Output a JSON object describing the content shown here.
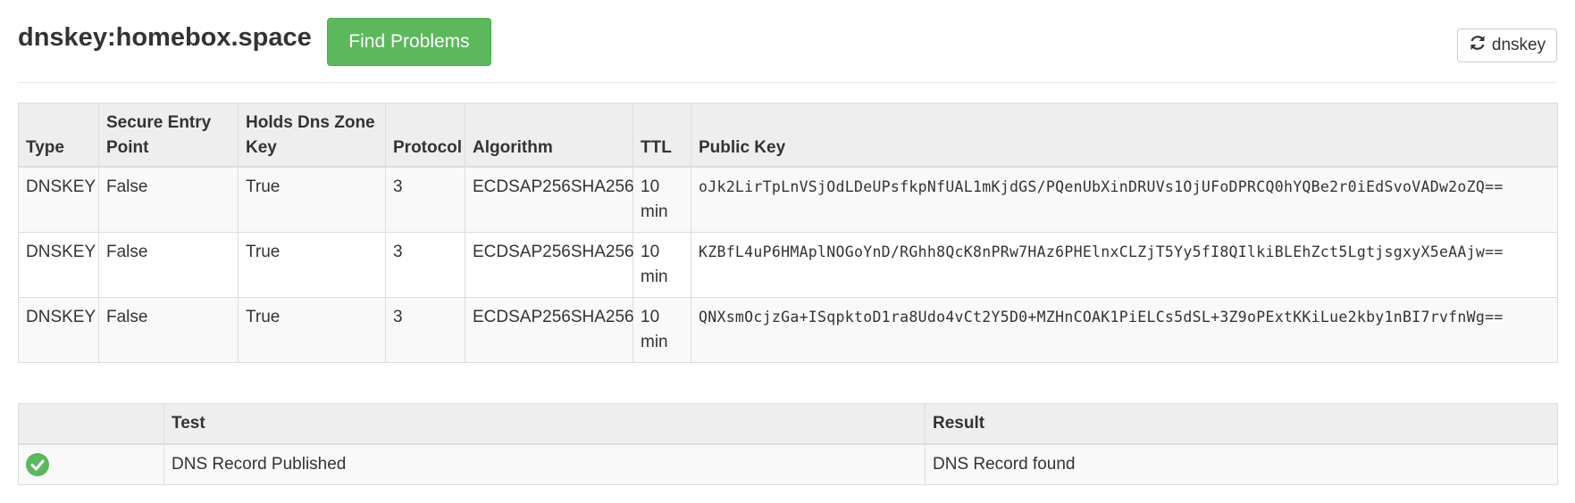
{
  "header": {
    "title": "dnskey:homebox.space",
    "find_button": "Find Problems",
    "refresh_button": "dnskey",
    "refresh_icon": "refresh-icon"
  },
  "dnskey_table": {
    "columns": [
      "Type",
      "Secure Entry Point",
      "Holds Dns Zone Key",
      "Protocol",
      "Algorithm",
      "TTL",
      "Public Key"
    ],
    "rows": [
      {
        "type": "DNSKEY",
        "sep": "False",
        "zone_key": "True",
        "protocol": "3",
        "algorithm": "ECDSAP256SHA256",
        "ttl": "10 min",
        "public_key": "oJk2LirTpLnVSjOdLDeUPsfkpNfUAL1mKjdGS/PQenUbXinDRUVs1OjUFoDPRCQ0hYQBe2r0iEdSvoVADw2oZQ=="
      },
      {
        "type": "DNSKEY",
        "sep": "False",
        "zone_key": "True",
        "protocol": "3",
        "algorithm": "ECDSAP256SHA256",
        "ttl": "10 min",
        "public_key": "KZBfL4uP6HMAplNOGoYnD/RGhh8QcK8nPRw7HAz6PHElnxCLZjT5Yy5fI8QIlkiBLEhZct5LgtjsgxyX5eAAjw=="
      },
      {
        "type": "DNSKEY",
        "sep": "False",
        "zone_key": "True",
        "protocol": "3",
        "algorithm": "ECDSAP256SHA256",
        "ttl": "10 min",
        "public_key": "QNXsmOcjzGa+ISqpktoD1ra8Udo4vCt2Y5D0+MZHnCOAK1PiELCs5dSL+3Z9oPExtKKiLue2kby1nBI7rvfnWg=="
      }
    ]
  },
  "test_table": {
    "columns": [
      "",
      "Test",
      "Result"
    ],
    "rows": [
      {
        "status_icon": "check-circle-icon",
        "status_color": "#5cb85c",
        "test": "DNS Record Published",
        "result": "DNS Record found"
      }
    ]
  }
}
